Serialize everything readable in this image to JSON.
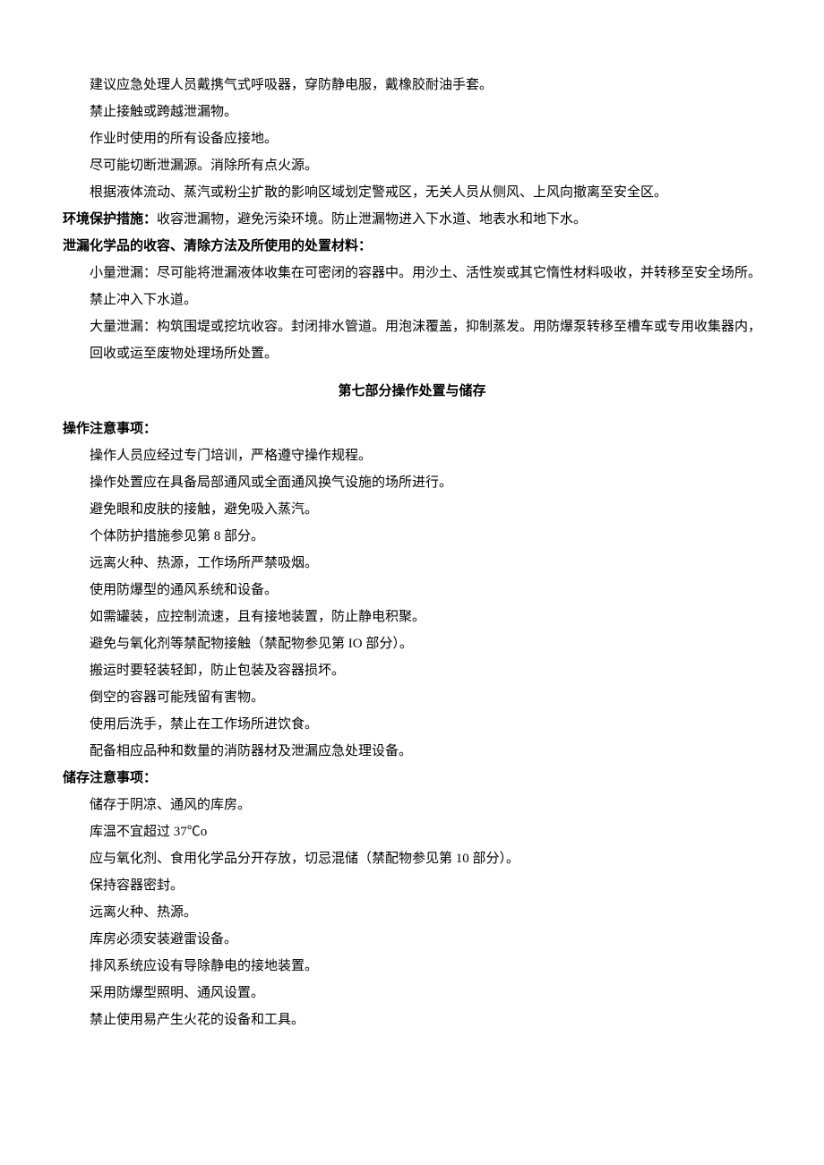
{
  "personal_protection": {
    "lines": [
      "建议应急处理人员戴携气式呼吸器，穿防静电服，戴橡胶耐油手套。",
      "禁止接触或跨越泄漏物。",
      "作业时使用的所有设备应接地。",
      "尽可能切断泄漏源。消除所有点火源。",
      "根据液体流动、蒸汽或粉尘扩散的影响区域划定警戒区，无关人员从侧风、上风向撤离至安全区。"
    ]
  },
  "env_protection": {
    "label": "环境保护措施：",
    "text": "收容泄漏物，避免污染环境。防止泄漏物进入下水道、地表水和地下水。"
  },
  "spill_cleanup": {
    "label": "泄漏化学品的收容、清除方法及所使用的处置材料：",
    "small": "小量泄漏：尽可能将泄漏液体收集在可密闭的容器中。用沙土、活性炭或其它惰性材料吸收，并转移至安全场所。禁止冲入下水道。",
    "large": "大量泄漏：构筑围堤或挖坑收容。封闭排水管道。用泡沫覆盖，抑制蒸发。用防爆泵转移至槽车或专用收集器内，回收或运至废物处理场所处置。"
  },
  "section7_title": "第七部分操作处置与储存",
  "operation": {
    "label": "操作注意事项：",
    "lines": [
      "操作人员应经过专门培训，严格遵守操作规程。",
      "操作处置应在具备局部通风或全面通风换气设施的场所进行。",
      "避免眼和皮肤的接触，避免吸入蒸汽。",
      "个体防护措施参见第 8 部分。",
      "远离火种、热源，工作场所严禁吸烟。",
      "使用防爆型的通风系统和设备。",
      "如需罐装，应控制流速，且有接地装置，防止静电积聚。",
      "避免与氧化剂等禁配物接触（禁配物参见第 IO 部分）。",
      "搬运时要轻装轻卸，防止包装及容器损坏。",
      "倒空的容器可能残留有害物。",
      "使用后洗手，禁止在工作场所进饮食。",
      "配备相应品种和数量的消防器材及泄漏应急处理设备。"
    ]
  },
  "storage": {
    "label": "储存注意事项：",
    "lines": [
      "储存于阴凉、通风的库房。",
      "库温不宜超过 37℃o",
      "应与氧化剂、食用化学品分开存放，切忌混储（禁配物参见第 10 部分）。",
      "保持容器密封。",
      "远离火种、热源。",
      "库房必须安装避雷设备。",
      "排风系统应设有导除静电的接地装置。",
      "采用防爆型照明、通风设置。",
      "禁止使用易产生火花的设备和工具。"
    ]
  }
}
